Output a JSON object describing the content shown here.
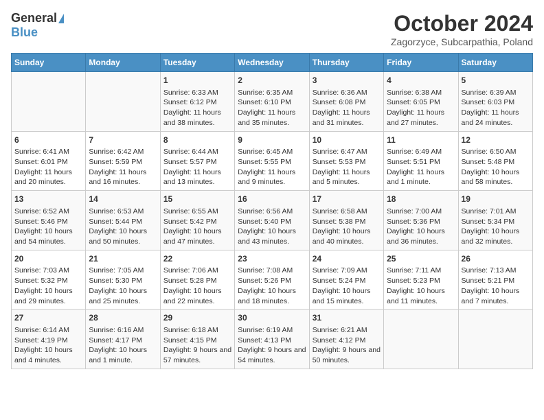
{
  "logo": {
    "general": "General",
    "blue": "Blue"
  },
  "title": {
    "month": "October 2024",
    "location": "Zagorzyce, Subcarpathia, Poland"
  },
  "days_of_week": [
    "Sunday",
    "Monday",
    "Tuesday",
    "Wednesday",
    "Thursday",
    "Friday",
    "Saturday"
  ],
  "weeks": [
    [
      {
        "day": "",
        "info": ""
      },
      {
        "day": "",
        "info": ""
      },
      {
        "day": "1",
        "info": "Sunrise: 6:33 AM\nSunset: 6:12 PM\nDaylight: 11 hours and 38 minutes."
      },
      {
        "day": "2",
        "info": "Sunrise: 6:35 AM\nSunset: 6:10 PM\nDaylight: 11 hours and 35 minutes."
      },
      {
        "day": "3",
        "info": "Sunrise: 6:36 AM\nSunset: 6:08 PM\nDaylight: 11 hours and 31 minutes."
      },
      {
        "day": "4",
        "info": "Sunrise: 6:38 AM\nSunset: 6:05 PM\nDaylight: 11 hours and 27 minutes."
      },
      {
        "day": "5",
        "info": "Sunrise: 6:39 AM\nSunset: 6:03 PM\nDaylight: 11 hours and 24 minutes."
      }
    ],
    [
      {
        "day": "6",
        "info": "Sunrise: 6:41 AM\nSunset: 6:01 PM\nDaylight: 11 hours and 20 minutes."
      },
      {
        "day": "7",
        "info": "Sunrise: 6:42 AM\nSunset: 5:59 PM\nDaylight: 11 hours and 16 minutes."
      },
      {
        "day": "8",
        "info": "Sunrise: 6:44 AM\nSunset: 5:57 PM\nDaylight: 11 hours and 13 minutes."
      },
      {
        "day": "9",
        "info": "Sunrise: 6:45 AM\nSunset: 5:55 PM\nDaylight: 11 hours and 9 minutes."
      },
      {
        "day": "10",
        "info": "Sunrise: 6:47 AM\nSunset: 5:53 PM\nDaylight: 11 hours and 5 minutes."
      },
      {
        "day": "11",
        "info": "Sunrise: 6:49 AM\nSunset: 5:51 PM\nDaylight: 11 hours and 1 minute."
      },
      {
        "day": "12",
        "info": "Sunrise: 6:50 AM\nSunset: 5:48 PM\nDaylight: 10 hours and 58 minutes."
      }
    ],
    [
      {
        "day": "13",
        "info": "Sunrise: 6:52 AM\nSunset: 5:46 PM\nDaylight: 10 hours and 54 minutes."
      },
      {
        "day": "14",
        "info": "Sunrise: 6:53 AM\nSunset: 5:44 PM\nDaylight: 10 hours and 50 minutes."
      },
      {
        "day": "15",
        "info": "Sunrise: 6:55 AM\nSunset: 5:42 PM\nDaylight: 10 hours and 47 minutes."
      },
      {
        "day": "16",
        "info": "Sunrise: 6:56 AM\nSunset: 5:40 PM\nDaylight: 10 hours and 43 minutes."
      },
      {
        "day": "17",
        "info": "Sunrise: 6:58 AM\nSunset: 5:38 PM\nDaylight: 10 hours and 40 minutes."
      },
      {
        "day": "18",
        "info": "Sunrise: 7:00 AM\nSunset: 5:36 PM\nDaylight: 10 hours and 36 minutes."
      },
      {
        "day": "19",
        "info": "Sunrise: 7:01 AM\nSunset: 5:34 PM\nDaylight: 10 hours and 32 minutes."
      }
    ],
    [
      {
        "day": "20",
        "info": "Sunrise: 7:03 AM\nSunset: 5:32 PM\nDaylight: 10 hours and 29 minutes."
      },
      {
        "day": "21",
        "info": "Sunrise: 7:05 AM\nSunset: 5:30 PM\nDaylight: 10 hours and 25 minutes."
      },
      {
        "day": "22",
        "info": "Sunrise: 7:06 AM\nSunset: 5:28 PM\nDaylight: 10 hours and 22 minutes."
      },
      {
        "day": "23",
        "info": "Sunrise: 7:08 AM\nSunset: 5:26 PM\nDaylight: 10 hours and 18 minutes."
      },
      {
        "day": "24",
        "info": "Sunrise: 7:09 AM\nSunset: 5:24 PM\nDaylight: 10 hours and 15 minutes."
      },
      {
        "day": "25",
        "info": "Sunrise: 7:11 AM\nSunset: 5:23 PM\nDaylight: 10 hours and 11 minutes."
      },
      {
        "day": "26",
        "info": "Sunrise: 7:13 AM\nSunset: 5:21 PM\nDaylight: 10 hours and 7 minutes."
      }
    ],
    [
      {
        "day": "27",
        "info": "Sunrise: 6:14 AM\nSunset: 4:19 PM\nDaylight: 10 hours and 4 minutes."
      },
      {
        "day": "28",
        "info": "Sunrise: 6:16 AM\nSunset: 4:17 PM\nDaylight: 10 hours and 1 minute."
      },
      {
        "day": "29",
        "info": "Sunrise: 6:18 AM\nSunset: 4:15 PM\nDaylight: 9 hours and 57 minutes."
      },
      {
        "day": "30",
        "info": "Sunrise: 6:19 AM\nSunset: 4:13 PM\nDaylight: 9 hours and 54 minutes."
      },
      {
        "day": "31",
        "info": "Sunrise: 6:21 AM\nSunset: 4:12 PM\nDaylight: 9 hours and 50 minutes."
      },
      {
        "day": "",
        "info": ""
      },
      {
        "day": "",
        "info": ""
      }
    ]
  ]
}
